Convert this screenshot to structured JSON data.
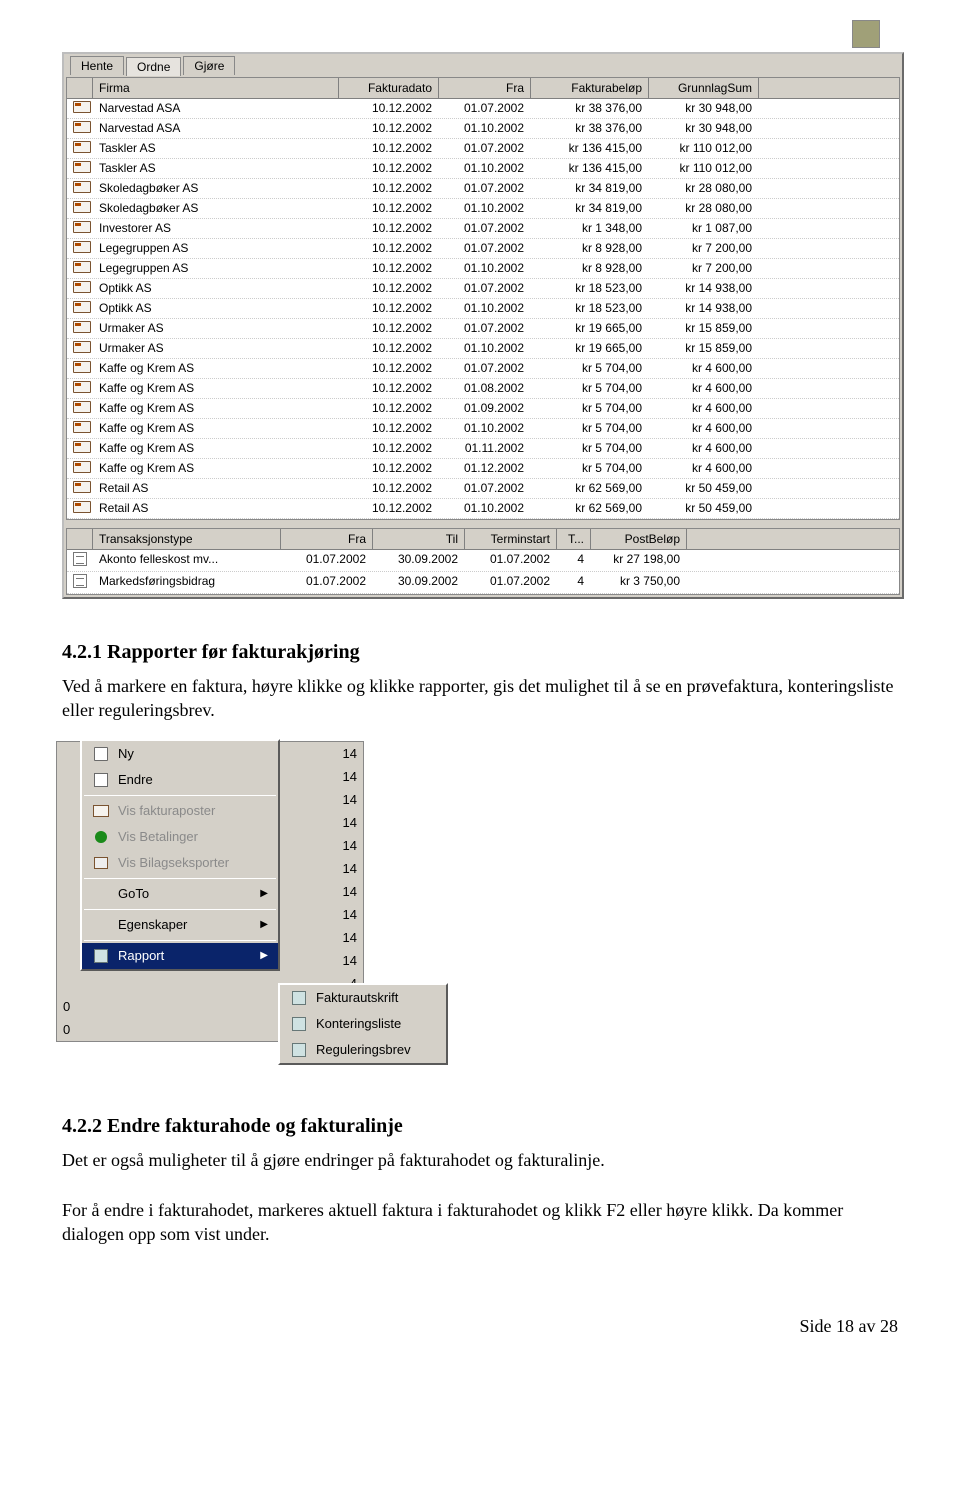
{
  "tabs": {
    "hente": "Hente",
    "ordne": "Ordne",
    "gjore": "Gjøre"
  },
  "grid1": {
    "headers": {
      "firma": "Firma",
      "fdato": "Fakturadato",
      "fra": "Fra",
      "belop": "Fakturabeløp",
      "grunn": "GrunnlagSum"
    },
    "rows": [
      {
        "firma": "Narvestad ASA",
        "fdato": "10.12.2002",
        "fra": "01.07.2002",
        "belop": "kr 38 376,00",
        "grunn": "kr 30 948,00"
      },
      {
        "firma": "Narvestad ASA",
        "fdato": "10.12.2002",
        "fra": "01.10.2002",
        "belop": "kr 38 376,00",
        "grunn": "kr 30 948,00"
      },
      {
        "firma": "Taskler AS",
        "fdato": "10.12.2002",
        "fra": "01.07.2002",
        "belop": "kr 136 415,00",
        "grunn": "kr 110 012,00"
      },
      {
        "firma": "Taskler AS",
        "fdato": "10.12.2002",
        "fra": "01.10.2002",
        "belop": "kr 136 415,00",
        "grunn": "kr 110 012,00"
      },
      {
        "firma": "Skoledagbøker AS",
        "fdato": "10.12.2002",
        "fra": "01.07.2002",
        "belop": "kr 34 819,00",
        "grunn": "kr 28 080,00"
      },
      {
        "firma": "Skoledagbøker AS",
        "fdato": "10.12.2002",
        "fra": "01.10.2002",
        "belop": "kr 34 819,00",
        "grunn": "kr 28 080,00"
      },
      {
        "firma": "Investorer AS",
        "fdato": "10.12.2002",
        "fra": "01.07.2002",
        "belop": "kr 1 348,00",
        "grunn": "kr 1 087,00"
      },
      {
        "firma": "Legegruppen AS",
        "fdato": "10.12.2002",
        "fra": "01.07.2002",
        "belop": "kr 8 928,00",
        "grunn": "kr 7 200,00"
      },
      {
        "firma": "Legegruppen AS",
        "fdato": "10.12.2002",
        "fra": "01.10.2002",
        "belop": "kr 8 928,00",
        "grunn": "kr 7 200,00"
      },
      {
        "firma": "Optikk AS",
        "fdato": "10.12.2002",
        "fra": "01.07.2002",
        "belop": "kr 18 523,00",
        "grunn": "kr 14 938,00"
      },
      {
        "firma": "Optikk AS",
        "fdato": "10.12.2002",
        "fra": "01.10.2002",
        "belop": "kr 18 523,00",
        "grunn": "kr 14 938,00"
      },
      {
        "firma": "Urmaker AS",
        "fdato": "10.12.2002",
        "fra": "01.07.2002",
        "belop": "kr 19 665,00",
        "grunn": "kr 15 859,00"
      },
      {
        "firma": "Urmaker AS",
        "fdato": "10.12.2002",
        "fra": "01.10.2002",
        "belop": "kr 19 665,00",
        "grunn": "kr 15 859,00"
      },
      {
        "firma": "Kaffe og Krem AS",
        "fdato": "10.12.2002",
        "fra": "01.07.2002",
        "belop": "kr 5 704,00",
        "grunn": "kr 4 600,00"
      },
      {
        "firma": "Kaffe og Krem AS",
        "fdato": "10.12.2002",
        "fra": "01.08.2002",
        "belop": "kr 5 704,00",
        "grunn": "kr 4 600,00"
      },
      {
        "firma": "Kaffe og Krem AS",
        "fdato": "10.12.2002",
        "fra": "01.09.2002",
        "belop": "kr 5 704,00",
        "grunn": "kr 4 600,00"
      },
      {
        "firma": "Kaffe og Krem AS",
        "fdato": "10.12.2002",
        "fra": "01.10.2002",
        "belop": "kr 5 704,00",
        "grunn": "kr 4 600,00"
      },
      {
        "firma": "Kaffe og Krem AS",
        "fdato": "10.12.2002",
        "fra": "01.11.2002",
        "belop": "kr 5 704,00",
        "grunn": "kr 4 600,00"
      },
      {
        "firma": "Kaffe og Krem AS",
        "fdato": "10.12.2002",
        "fra": "01.12.2002",
        "belop": "kr 5 704,00",
        "grunn": "kr 4 600,00"
      },
      {
        "firma": "Retail AS",
        "fdato": "10.12.2002",
        "fra": "01.07.2002",
        "belop": "kr 62 569,00",
        "grunn": "kr 50 459,00"
      },
      {
        "firma": "Retail AS",
        "fdato": "10.12.2002",
        "fra": "01.10.2002",
        "belop": "kr 62 569,00",
        "grunn": "kr 50 459,00"
      }
    ]
  },
  "grid2": {
    "headers": {
      "type": "Transaksjonstype",
      "fra": "Fra",
      "til": "Til",
      "term": "Terminstart",
      "t": "T...",
      "post": "PostBeløp"
    },
    "rows": [
      {
        "type": "Akonto felleskost mv...",
        "fra": "01.07.2002",
        "til": "30.09.2002",
        "term": "01.07.2002",
        "t": "4",
        "post": "kr 27 198,00"
      },
      {
        "type": "Markedsføringsbidrag",
        "fra": "01.07.2002",
        "til": "30.09.2002",
        "term": "01.07.2002",
        "t": "4",
        "post": "kr 3 750,00"
      }
    ]
  },
  "sec1": {
    "heading": "4.2.1   Rapporter før fakturakjøring",
    "para": "Ved å markere en faktura, høyre klikke og klikke rapporter, gis det mulighet til å se en prøvefaktura, konteringsliste eller reguleringsbrev."
  },
  "menu": {
    "ny": "Ny",
    "endre": "Endre",
    "vis_faktura": "Vis fakturaposter",
    "vis_bet": "Vis Betalinger",
    "vis_bilag": "Vis Bilagseksporter",
    "goto": "GoTo",
    "egenskaper": "Egenskaper",
    "rapport": "Rapport",
    "sub": {
      "a": "Fakturautskrift",
      "b": "Konteringsliste",
      "c": "Reguleringsbrev"
    },
    "n14": "14",
    "n0": "0"
  },
  "sec2": {
    "heading": "4.2.2   Endre fakturahode og fakturalinje",
    "p1": "Det er også muligheter til å gjøre endringer på fakturahodet og fakturalinje.",
    "p2": "For å endre i fakturahodet, markeres aktuell faktura i fakturahodet og klikk F2 eller høyre klikk. Da kommer dialogen opp som vist under."
  },
  "footer": "Side 18 av 28"
}
